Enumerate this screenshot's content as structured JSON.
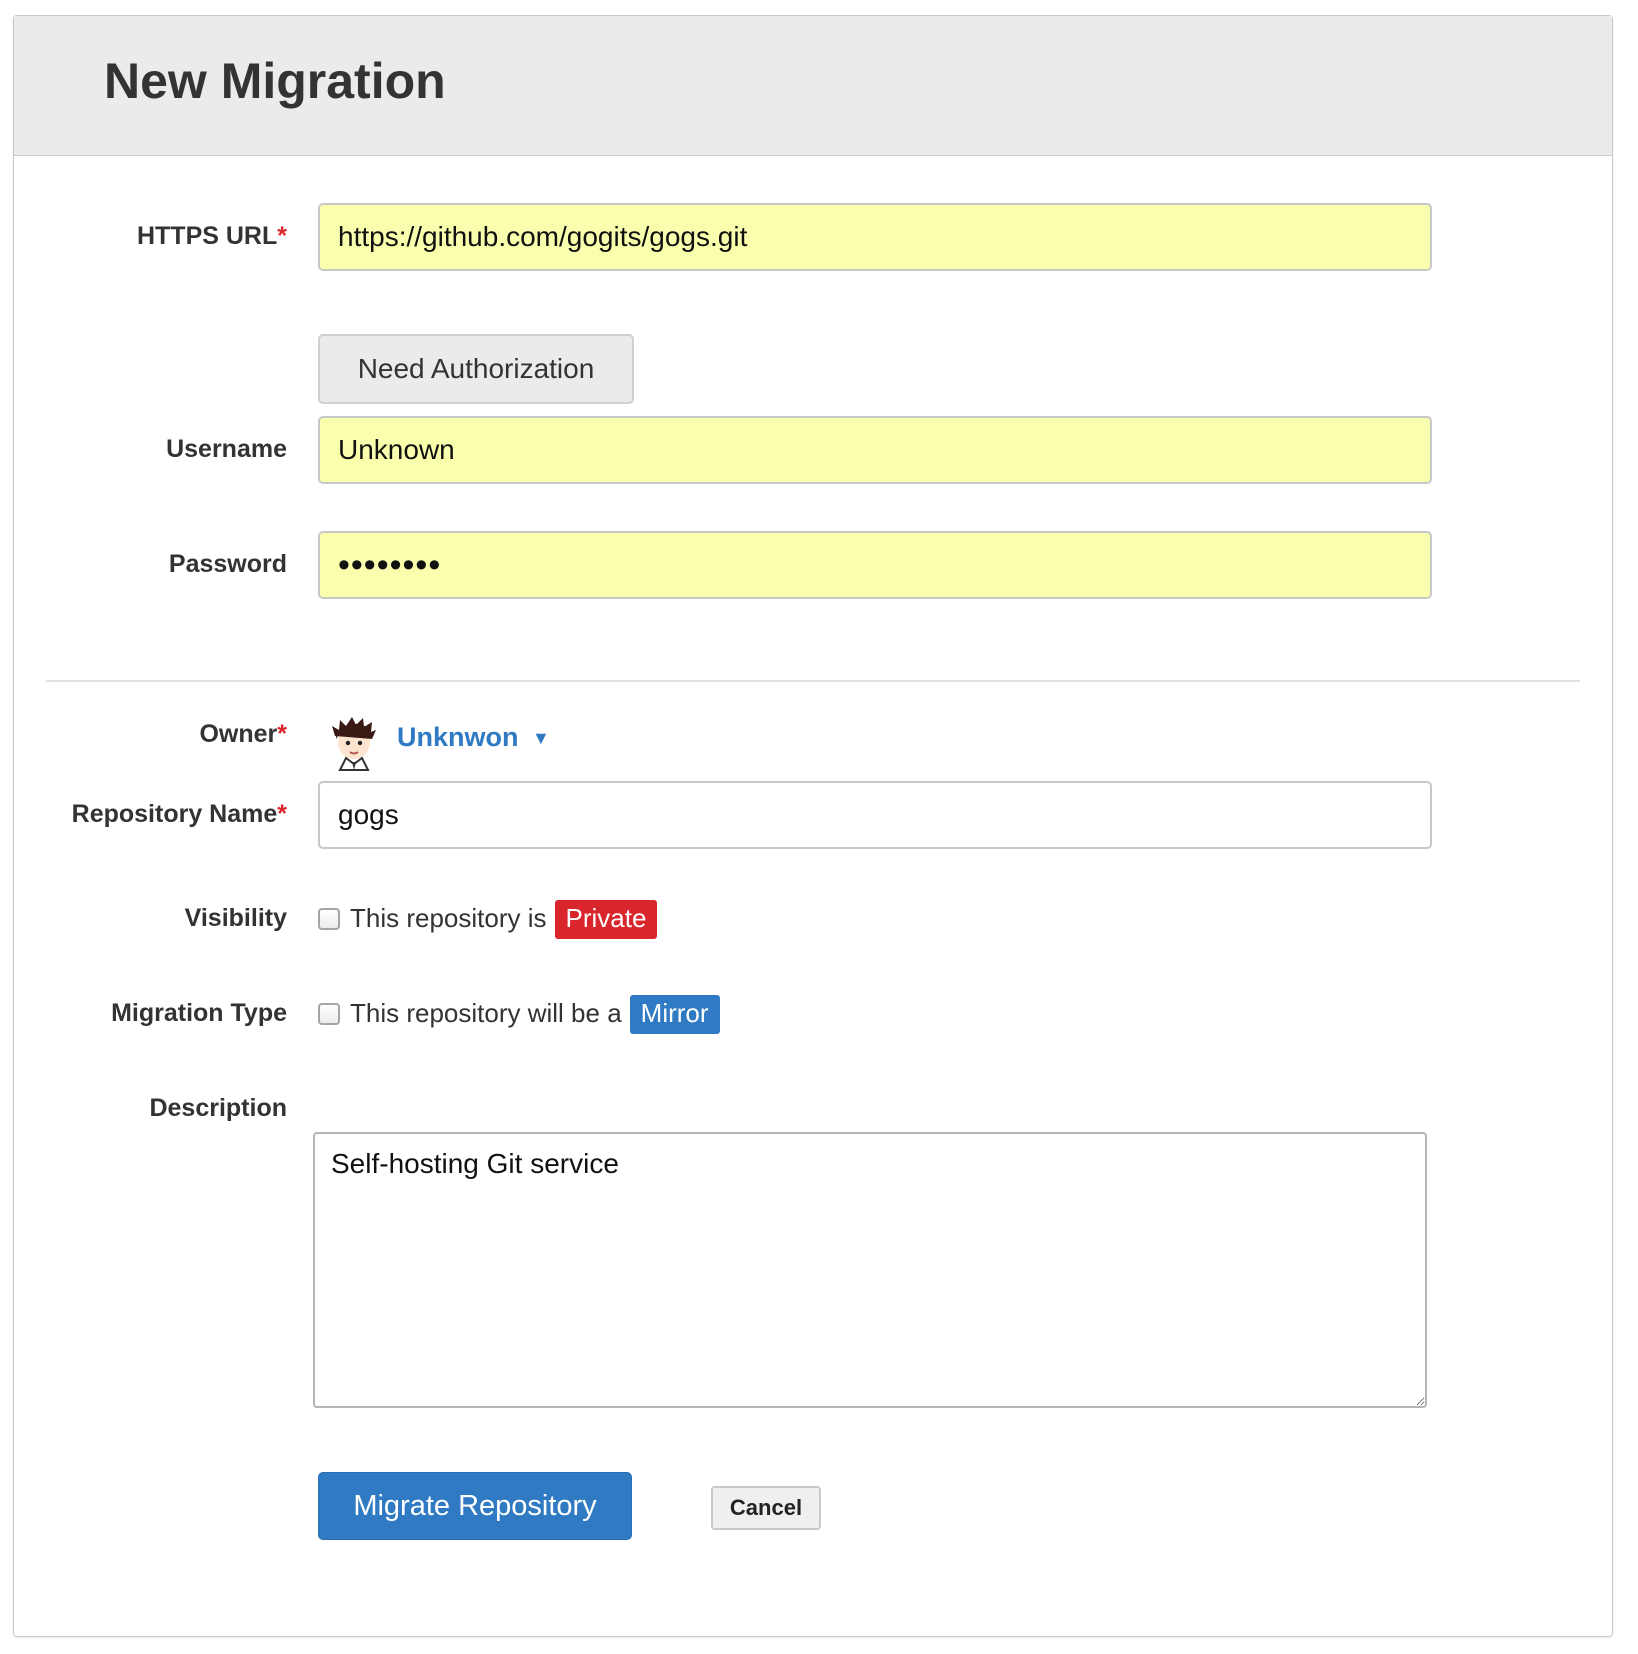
{
  "page": {
    "title": "New Migration"
  },
  "form": {
    "https_url": {
      "label": "HTTPS URL",
      "required_mark": "*",
      "value": "https://github.com/gogits/gogs.git"
    },
    "need_auth_button": "Need Authorization",
    "username": {
      "label": "Username",
      "value": "Unknown"
    },
    "password": {
      "label": "Password",
      "value": "••••••••"
    },
    "owner": {
      "label": "Owner",
      "required_mark": "*",
      "name": "Unknwon",
      "caret": "▼"
    },
    "repo_name": {
      "label": "Repository Name",
      "required_mark": "*",
      "value": "gogs"
    },
    "visibility": {
      "label": "Visibility",
      "checkbox_text": "This repository is",
      "badge": "Private",
      "checked": false
    },
    "migration_type": {
      "label": "Migration Type",
      "checkbox_text": "This repository will be a",
      "badge": "Mirror",
      "checked": false
    },
    "description": {
      "label": "Description",
      "value": "Self-hosting Git service"
    },
    "submit_button": "Migrate Repository",
    "cancel_button": "Cancel"
  },
  "colors": {
    "primary": "#2f7ac3",
    "danger": "#d9262c",
    "autofill": "#f9ffad",
    "header_bg": "#ebebeb"
  }
}
